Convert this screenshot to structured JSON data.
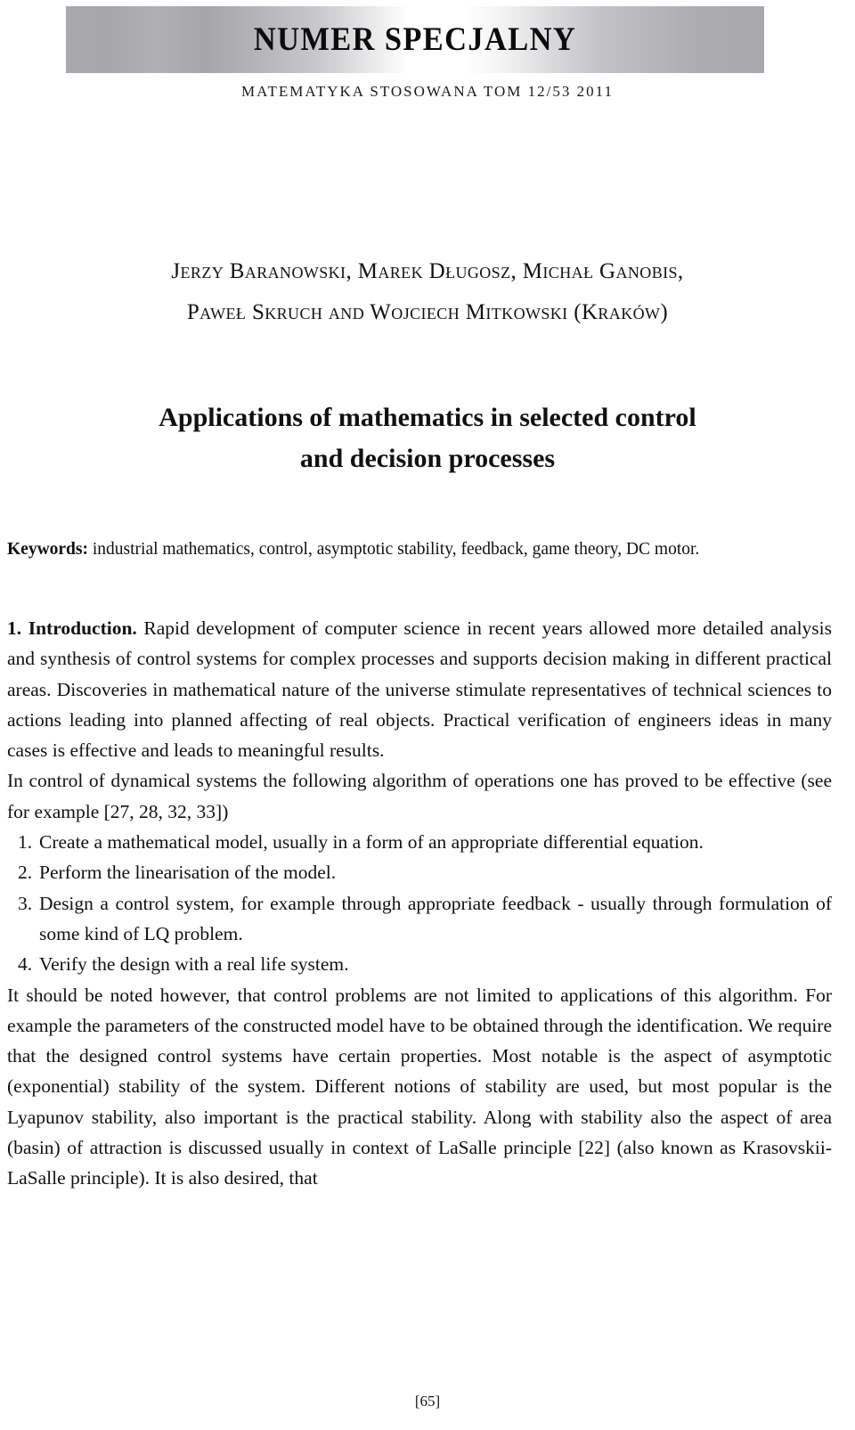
{
  "masthead": {
    "banner_title": "NUMER SPECJALNY",
    "journal_line": "MATEMATYKA STOSOWANA TOM 12/53 2011",
    "banner_edge_color": "#a9a9ad",
    "banner_center_color": "#ffffff"
  },
  "authors": {
    "line1": "Jerzy Baranowski, Marek Długosz, Michał Ganobis,",
    "line2": "Paweł Skruch and Wojciech Mitkowski (Kraków)"
  },
  "paper_title": {
    "line1": "Applications of mathematics in selected control",
    "line2": "and decision processes"
  },
  "keywords": {
    "label": "Keywords:",
    "text": " industrial mathematics, control, asymptotic stability, feedback, game theory, DC motor."
  },
  "intro": {
    "section_number": "1.",
    "section_title": "Introduction.",
    "paragraph1": " Rapid development of computer science in recent years allowed more detailed analysis and synthesis of control systems for complex processes and supports decision making in different practical areas. Discoveries in mathematical nature of the universe stimulate representatives of technical sciences to actions leading into planned affecting of real objects. Practical verification of engineers ideas in many cases is effective and leads to meaningful results.",
    "paragraph2": "In control of dynamical systems the following algorithm of operations one has proved to be effective (see for example [27, 28, 32, 33])",
    "algorithm_steps": [
      {
        "num": "1.",
        "text": "Create a mathematical model, usually in a form of an appropriate differential equation."
      },
      {
        "num": "2.",
        "text": "Perform the linearisation of the model."
      },
      {
        "num": "3.",
        "text": "Design a control system, for example through appropriate feedback - usually through formulation of some kind of LQ problem."
      },
      {
        "num": "4.",
        "text": "Verify the design with a real life system."
      }
    ],
    "paragraph3": "It should be noted however, that control problems are not limited to applications of this algorithm. For example the parameters of the constructed model have to be obtained through the identification. We require that the designed control systems have certain properties. Most notable is the aspect of asymptotic (exponential) stability of the system. Different notions of stability are used, but most popular is the Lyapunov stability, also important is the practical stability. Along with stability also the aspect of area (basin) of attraction is discussed usually in context of LaSalle principle [22] (also known as Krasovskii-LaSalle principle). It is also desired, that"
  },
  "footer": {
    "page_number": "[65]"
  }
}
